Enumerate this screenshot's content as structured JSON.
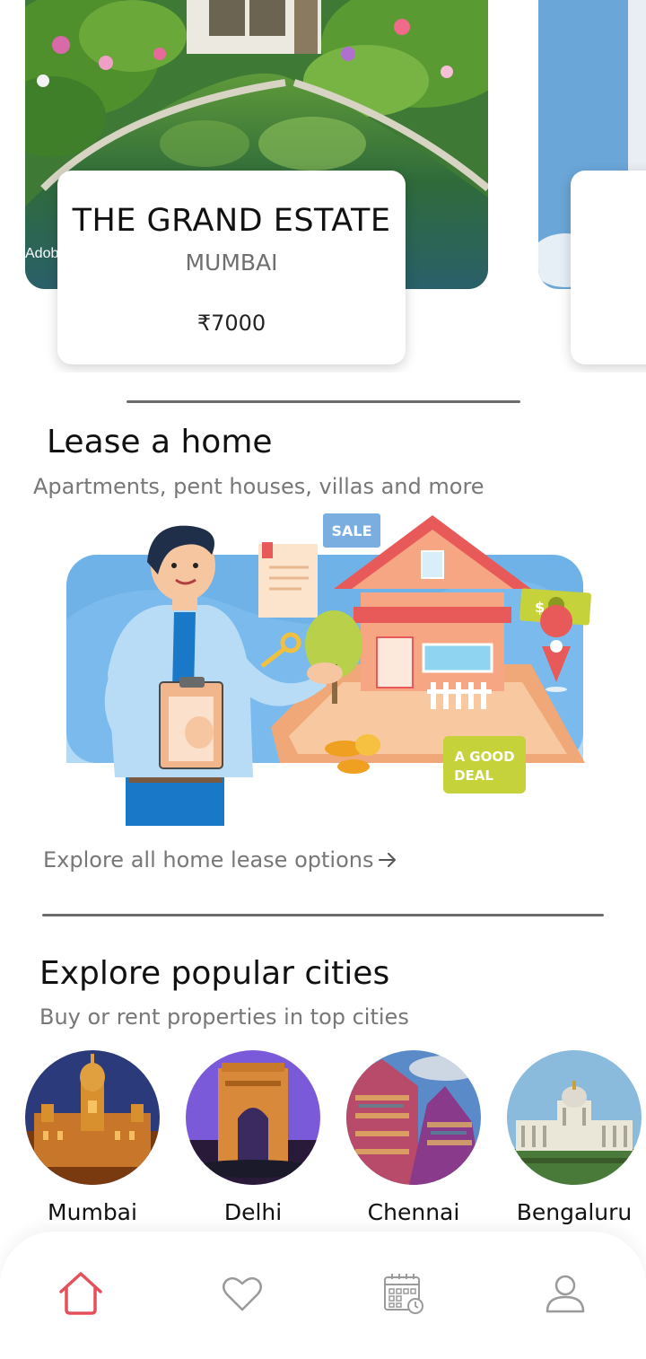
{
  "featured": [
    {
      "name": "THE GRAND ESTATE",
      "city": "MUMBAI",
      "price": "₹7000",
      "watermark": "Adob"
    }
  ],
  "lease": {
    "title": "Lease a home",
    "subtitle": "Apartments, pent houses, villas and more",
    "illustration": {
      "sale_tag": "SALE",
      "deal_tag_line1": "A GOOD",
      "deal_tag_line2": "DEAL",
      "money_symbol": "$"
    },
    "explore_link": "Explore all home lease options"
  },
  "cities": {
    "title": "Explore popular cities",
    "subtitle": "Buy or rent properties in top cities",
    "items": [
      {
        "name": "Mumbai"
      },
      {
        "name": "Delhi"
      },
      {
        "name": "Chennai"
      },
      {
        "name": "Bengaluru"
      }
    ]
  },
  "nav": {
    "items": [
      {
        "icon": "home-icon",
        "active": true
      },
      {
        "icon": "heart-icon",
        "active": false
      },
      {
        "icon": "calendar-icon",
        "active": false
      },
      {
        "icon": "profile-icon",
        "active": false
      }
    ],
    "active_color": "#e5505a",
    "inactive_color": "#9a9a9a"
  }
}
